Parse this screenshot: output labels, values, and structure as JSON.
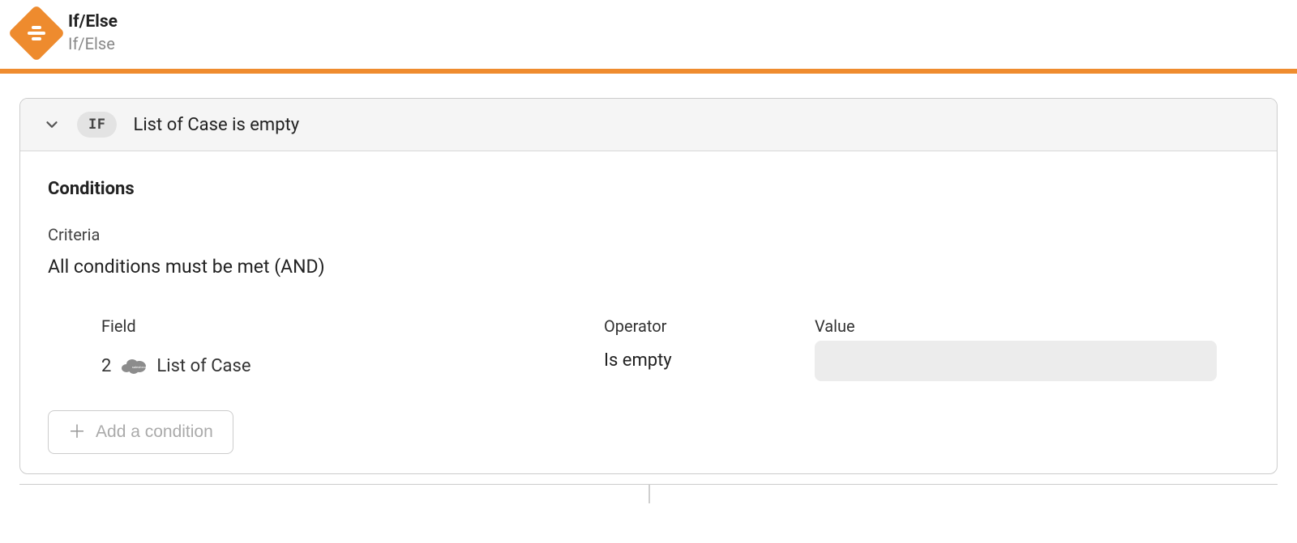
{
  "header": {
    "title": "If/Else",
    "subtitle": "If/Else"
  },
  "panel": {
    "badge": "IF",
    "title": "List of Case is empty"
  },
  "conditions": {
    "section_title": "Conditions",
    "criteria_label": "Criteria",
    "criteria_value": "All conditions must be met (AND)",
    "columns": {
      "field": "Field",
      "operator": "Operator",
      "value": "Value"
    },
    "rows": [
      {
        "step": "2",
        "field_label": "List of Case",
        "operator": "Is empty",
        "value": ""
      }
    ],
    "add_button_label": "Add a condition"
  }
}
